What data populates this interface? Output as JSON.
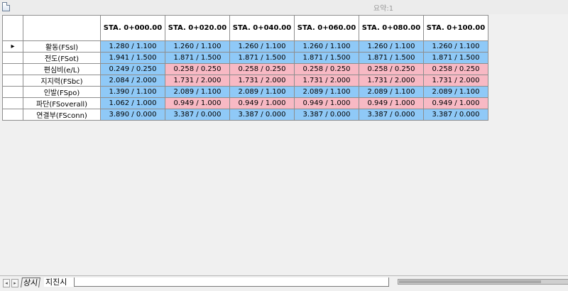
{
  "window": {
    "title": "요약:1"
  },
  "grid": {
    "columns": [
      "STA. 0+000.00",
      "STA. 0+020.00",
      "STA. 0+040.00",
      "STA. 0+060.00",
      "STA. 0+080.00",
      "STA. 0+100.00"
    ],
    "rows": [
      {
        "label": "활동(FSsl)",
        "current": true,
        "cells": [
          {
            "text": "1.280 / 1.100",
            "status": "ok"
          },
          {
            "text": "1.260 / 1.100",
            "status": "ok"
          },
          {
            "text": "1.260 / 1.100",
            "status": "ok"
          },
          {
            "text": "1.260 / 1.100",
            "status": "ok"
          },
          {
            "text": "1.260 / 1.100",
            "status": "ok"
          },
          {
            "text": "1.260 / 1.100",
            "status": "ok"
          }
        ]
      },
      {
        "label": "전도(FSot)",
        "current": false,
        "cells": [
          {
            "text": "1.941 / 1.500",
            "status": "ok"
          },
          {
            "text": "1.871 / 1.500",
            "status": "ok"
          },
          {
            "text": "1.871 / 1.500",
            "status": "ok"
          },
          {
            "text": "1.871 / 1.500",
            "status": "ok"
          },
          {
            "text": "1.871 / 1.500",
            "status": "ok"
          },
          {
            "text": "1.871 / 1.500",
            "status": "ok"
          }
        ]
      },
      {
        "label": "편심비(e/L)",
        "current": false,
        "cells": [
          {
            "text": "0.249 / 0.250",
            "status": "ok"
          },
          {
            "text": "0.258 / 0.250",
            "status": "ng"
          },
          {
            "text": "0.258 / 0.250",
            "status": "ng"
          },
          {
            "text": "0.258 / 0.250",
            "status": "ng"
          },
          {
            "text": "0.258 / 0.250",
            "status": "ng"
          },
          {
            "text": "0.258 / 0.250",
            "status": "ng"
          }
        ]
      },
      {
        "label": "지지력(FSbc)",
        "current": false,
        "cells": [
          {
            "text": "2.084 / 2.000",
            "status": "ok"
          },
          {
            "text": "1.731 / 2.000",
            "status": "ng"
          },
          {
            "text": "1.731 / 2.000",
            "status": "ng"
          },
          {
            "text": "1.731 / 2.000",
            "status": "ng"
          },
          {
            "text": "1.731 / 2.000",
            "status": "ng"
          },
          {
            "text": "1.731 / 2.000",
            "status": "ng"
          }
        ]
      },
      {
        "label": "인발(FSpo)",
        "current": false,
        "cells": [
          {
            "text": "1.390 / 1.100",
            "status": "ok"
          },
          {
            "text": "2.089 / 1.100",
            "status": "ok"
          },
          {
            "text": "2.089 / 1.100",
            "status": "ok"
          },
          {
            "text": "2.089 / 1.100",
            "status": "ok"
          },
          {
            "text": "2.089 / 1.100",
            "status": "ok"
          },
          {
            "text": "2.089 / 1.100",
            "status": "ok"
          }
        ]
      },
      {
        "label": "파단(FSoverall)",
        "current": false,
        "cells": [
          {
            "text": "1.062 / 1.000",
            "status": "ok"
          },
          {
            "text": "0.949 / 1.000",
            "status": "ng"
          },
          {
            "text": "0.949 / 1.000",
            "status": "ng"
          },
          {
            "text": "0.949 / 1.000",
            "status": "ng"
          },
          {
            "text": "0.949 / 1.000",
            "status": "ng"
          },
          {
            "text": "0.949 / 1.000",
            "status": "ng"
          }
        ]
      },
      {
        "label": "연결부(FSconn)",
        "current": false,
        "cells": [
          {
            "text": "3.890 / 0.000",
            "status": "ok"
          },
          {
            "text": "3.387 / 0.000",
            "status": "ok"
          },
          {
            "text": "3.387 / 0.000",
            "status": "ok"
          },
          {
            "text": "3.387 / 0.000",
            "status": "ok"
          },
          {
            "text": "3.387 / 0.000",
            "status": "ok"
          },
          {
            "text": "3.387 / 0.000",
            "status": "ok"
          }
        ]
      }
    ],
    "current_row_marker": "▸",
    "colors": {
      "ok": "#8fc9f7",
      "ng": "#f8b9c4"
    }
  },
  "tabs": [
    "상시",
    "지진시"
  ],
  "navigation": {
    "prev_icon": "◂",
    "next_icon": "▸"
  }
}
